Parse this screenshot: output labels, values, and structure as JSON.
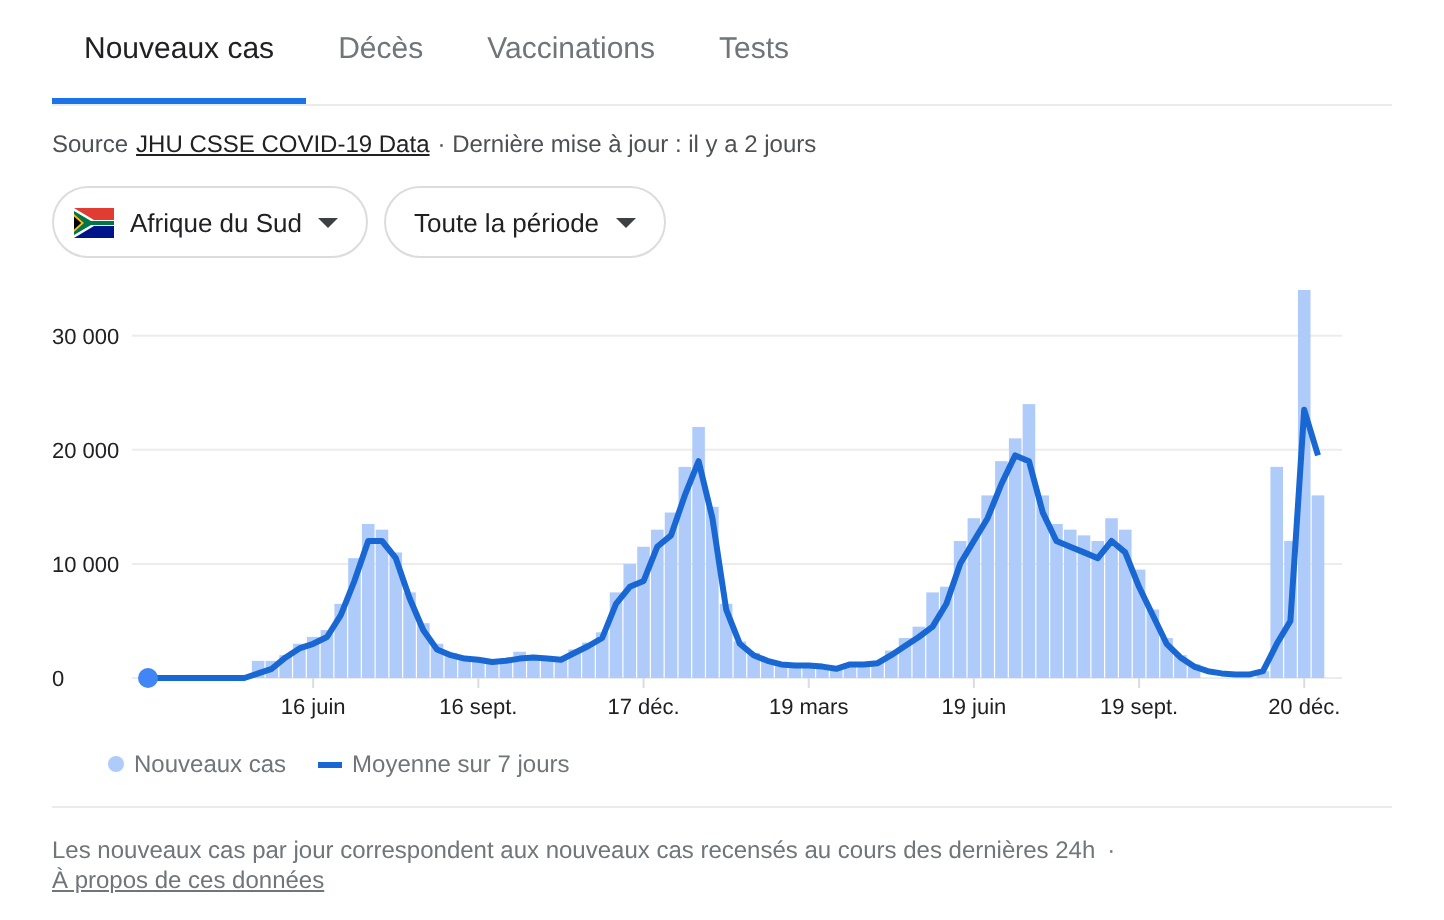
{
  "tabs": [
    {
      "label": "Nouveaux cas",
      "selected": true
    },
    {
      "label": "Décès",
      "selected": false
    },
    {
      "label": "Vaccinations",
      "selected": false
    },
    {
      "label": "Tests",
      "selected": false
    }
  ],
  "source": {
    "label": "Source",
    "link": "JHU CSSE COVID-19 Data",
    "updated": "· Dernière mise à jour : il y a 2 jours"
  },
  "filters": [
    {
      "label": "Afrique du Sud",
      "kind": "country"
    },
    {
      "label": "Toute la période",
      "kind": "period"
    }
  ],
  "chart": {
    "chart_data": {
      "type": "bar",
      "grid": true,
      "categories": [
        null,
        null,
        null,
        null,
        null,
        null,
        null,
        null,
        null,
        null,
        null,
        null,
        "16 juin",
        null,
        null,
        null,
        null,
        null,
        null,
        null,
        null,
        null,
        null,
        null,
        "16 sept.",
        null,
        null,
        null,
        null,
        null,
        null,
        null,
        null,
        null,
        null,
        null,
        "17 déc.",
        null,
        null,
        null,
        null,
        null,
        null,
        null,
        null,
        null,
        null,
        null,
        "19 mars",
        null,
        null,
        null,
        null,
        null,
        null,
        null,
        null,
        null,
        null,
        null,
        "19 juin",
        null,
        null,
        null,
        null,
        null,
        null,
        null,
        null,
        null,
        null,
        null,
        "19 sept.",
        null,
        null,
        null,
        null,
        null,
        null,
        null,
        null,
        null,
        null,
        null,
        "20 déc.",
        null
      ],
      "series": [
        {
          "name": "Nouveaux cas",
          "color": "#aecbfa",
          "type": "bar",
          "values": [
            0,
            0,
            0,
            0,
            0,
            0,
            0,
            0,
            1500,
            1500,
            2000,
            3000,
            3600,
            4200,
            6500,
            10500,
            13500,
            13000,
            11000,
            7500,
            4800,
            3000,
            2200,
            1900,
            1700,
            1500,
            1600,
            2300,
            1900,
            1800,
            1700,
            2500,
            3100,
            4000,
            7500,
            10000,
            11500,
            13000,
            14500,
            18500,
            22000,
            15000,
            6500,
            3200,
            2200,
            1600,
            1300,
            1200,
            1200,
            1100,
            900,
            1300,
            1300,
            1500,
            2400,
            3500,
            4500,
            7500,
            8000,
            12000,
            14000,
            16000,
            19000,
            21000,
            24000,
            16000,
            13500,
            13000,
            12500,
            12000,
            14000,
            13000,
            9500,
            6000,
            3500,
            2000,
            1200,
            null,
            null,
            null,
            null,
            600,
            18500,
            12000,
            34000,
            16000
          ]
        },
        {
          "name": "Moyenne sur 7 jours",
          "color": "#1967d2",
          "type": "line",
          "values": [
            0,
            0,
            0,
            0,
            0,
            0,
            0,
            0,
            400,
            800,
            1800,
            2600,
            3000,
            3600,
            5500,
            8500,
            12000,
            12000,
            10500,
            7000,
            4200,
            2500,
            2000,
            1700,
            1600,
            1400,
            1500,
            1700,
            1800,
            1700,
            1600,
            2200,
            2800,
            3500,
            6500,
            8000,
            8500,
            11500,
            12500,
            16000,
            19000,
            14000,
            6000,
            3000,
            2000,
            1500,
            1200,
            1100,
            1100,
            1000,
            800,
            1200,
            1200,
            1300,
            2000,
            2800,
            3600,
            4500,
            6500,
            10000,
            12000,
            14000,
            17000,
            19500,
            19000,
            14500,
            12000,
            11500,
            11000,
            10500,
            12000,
            11000,
            8000,
            5500,
            3000,
            1800,
            1000,
            600,
            400,
            300,
            300,
            600,
            3000,
            5000,
            23500,
            19500
          ]
        }
      ],
      "ylim": [
        0,
        34000
      ],
      "yticks": [
        {
          "value": 0,
          "label": "0"
        },
        {
          "value": 10000,
          "label": "10 000"
        },
        {
          "value": 20000,
          "label": "20 000"
        },
        {
          "value": 30000,
          "label": "30 000"
        }
      ]
    }
  },
  "footer": {
    "note": "Les nouveaux cas par jour correspondent aux nouveaux cas recensés au cours des dernières 24h",
    "separator": "·",
    "link": "À propos de ces données"
  }
}
